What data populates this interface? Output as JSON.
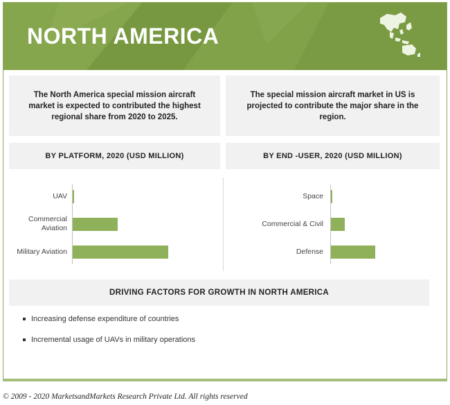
{
  "banner": {
    "title": "NORTH AMERICA",
    "icon": "asia-pacific-map-icon",
    "color": "#7d9e44"
  },
  "insights": [
    {
      "text": "The North America special mission aircraft market is expected to contributed the highest regional share from 2020 to 2025."
    },
    {
      "text": "The special mission aircraft market in US is projected to contribute the major share in the region."
    }
  ],
  "chart_data": [
    {
      "type": "bar",
      "orientation": "horizontal",
      "title": "BY PLATFORM, 2020 (USD MILLION)",
      "categories": [
        "UAV",
        "Commercial Aviation",
        "Military Aviation"
      ],
      "values": [
        2,
        65,
        138
      ],
      "xlim": [
        0,
        150
      ],
      "grid": false,
      "color": "#8eb15a"
    },
    {
      "type": "bar",
      "orientation": "horizontal",
      "title": "BY END -USER, 2020 (USD MILLION)",
      "categories": [
        "Space",
        "Commercial & Civil",
        "Defense"
      ],
      "values": [
        2,
        20,
        64
      ],
      "xlim": [
        0,
        150
      ],
      "grid": false,
      "color": "#8eb15a"
    }
  ],
  "drivers": {
    "heading": "DRIVING FACTORS FOR GROWTH IN NORTH AMERICA",
    "items": [
      "Increasing defense expenditure of countries",
      "Incremental usage of UAVs in military operations"
    ]
  },
  "footer": {
    "copyright": "© 2009 - 2020 MarketsandMarkets Research Private Ltd. All rights reserved"
  }
}
